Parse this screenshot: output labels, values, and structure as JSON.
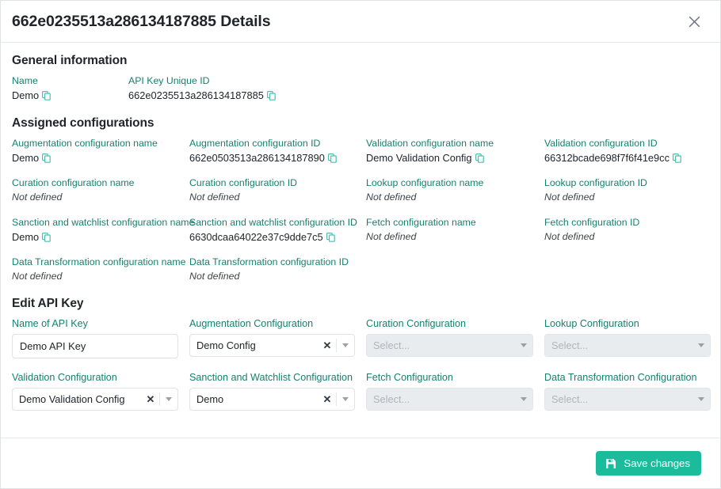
{
  "header": {
    "title": "662e0235513a286134187885 Details",
    "close_icon": "close-icon"
  },
  "general": {
    "heading": "General information",
    "fields": [
      {
        "label": "Name",
        "value": "Demo",
        "copyable": true
      },
      {
        "label": "API Key Unique ID",
        "value": "662e0235513a286134187885",
        "copyable": true
      }
    ]
  },
  "assigned": {
    "heading": "Assigned configurations",
    "fields": [
      {
        "label": "Augmentation configuration name",
        "value": "Demo",
        "copyable": true
      },
      {
        "label": "Augmentation configuration ID",
        "value": "662e0503513a286134187890",
        "copyable": true
      },
      {
        "label": "Validation configuration name",
        "value": "Demo Validation Config",
        "copyable": true
      },
      {
        "label": "Validation configuration ID",
        "value": "66312bcade698f7f6f41e9cc",
        "copyable": true
      },
      {
        "label": "Curation configuration name",
        "value": "Not defined",
        "copyable": false
      },
      {
        "label": "Curation configuration ID",
        "value": "Not defined",
        "copyable": false
      },
      {
        "label": "Lookup configuration name",
        "value": "Not defined",
        "copyable": false
      },
      {
        "label": "Lookup configuration ID",
        "value": "Not defined",
        "copyable": false
      },
      {
        "label": "Sanction and watchlist configuration name",
        "value": "Demo",
        "copyable": true
      },
      {
        "label": "Sanction and watchlist configuration ID",
        "value": "6630dcaa64022e37c9dde7c5",
        "copyable": true
      },
      {
        "label": "Fetch configuration name",
        "value": "Not defined",
        "copyable": false
      },
      {
        "label": "Fetch configuration ID",
        "value": "Not defined",
        "copyable": false
      },
      {
        "label": "Data Transformation configuration name",
        "value": "Not defined",
        "copyable": false
      },
      {
        "label": "Data Transformation configuration ID",
        "value": "Not defined",
        "copyable": false
      }
    ]
  },
  "edit": {
    "heading": "Edit API Key",
    "name_field": {
      "label": "Name of API Key",
      "value": "Demo API Key"
    },
    "selects": [
      {
        "label": "Augmentation Configuration",
        "value": "Demo Config",
        "placeholder": "",
        "disabled": false,
        "clearable": true
      },
      {
        "label": "Curation Configuration",
        "value": "",
        "placeholder": "Select...",
        "disabled": true,
        "clearable": false
      },
      {
        "label": "Lookup Configuration",
        "value": "",
        "placeholder": "Select...",
        "disabled": true,
        "clearable": false
      },
      {
        "label": "Validation Configuration",
        "value": "Demo Validation Config",
        "placeholder": "",
        "disabled": false,
        "clearable": true
      },
      {
        "label": "Sanction and Watchlist Configuration",
        "value": "Demo",
        "placeholder": "",
        "disabled": false,
        "clearable": true
      },
      {
        "label": "Fetch Configuration",
        "value": "",
        "placeholder": "Select...",
        "disabled": true,
        "clearable": false
      },
      {
        "label": "Data Transformation Configuration",
        "value": "",
        "placeholder": "Select...",
        "disabled": true,
        "clearable": false
      }
    ],
    "clear_symbol": "✕"
  },
  "footer": {
    "save_label": "Save changes",
    "save_icon": "save-disk-icon"
  },
  "colors": {
    "accent_teal": "#17806f",
    "button_teal": "#1abc9c",
    "text": "#212529",
    "muted": "#aeb5bb",
    "border": "#dfe3e6",
    "disabled_bg": "#e9ecef"
  }
}
